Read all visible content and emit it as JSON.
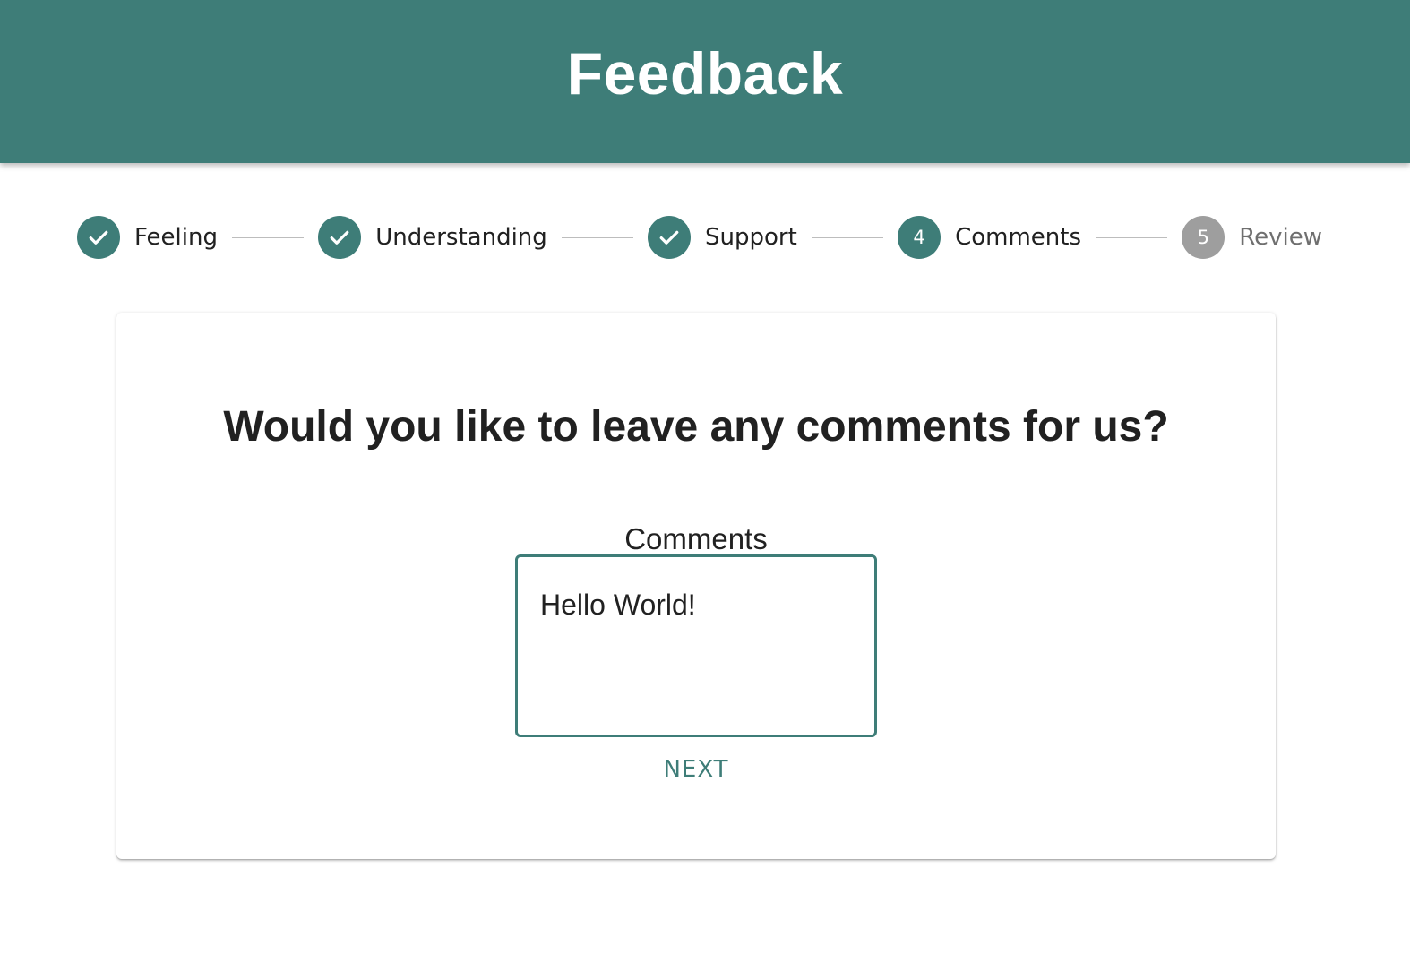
{
  "header": {
    "title": "Feedback"
  },
  "stepper": {
    "steps": [
      {
        "label": "Feeling",
        "state": "completed",
        "icon": "check-icon"
      },
      {
        "label": "Understanding",
        "state": "completed",
        "icon": "check-icon"
      },
      {
        "label": "Support",
        "state": "completed",
        "icon": "check-icon"
      },
      {
        "label": "Comments",
        "state": "active",
        "number": "4"
      },
      {
        "label": "Review",
        "state": "pending",
        "number": "5"
      }
    ]
  },
  "card": {
    "question": "Would you like to leave any comments for us?",
    "comments_label": "Comments",
    "comments_value": "Hello World!",
    "next_label": "NEXT"
  },
  "colors": {
    "primary": "#3e7d78",
    "pending": "#9e9e9e",
    "text": "#212121",
    "connector": "#bdbdbd"
  }
}
